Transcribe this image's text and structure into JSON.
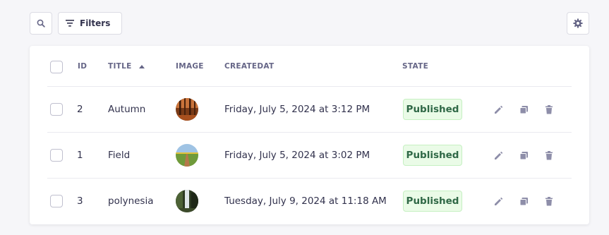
{
  "toolbar": {
    "filters_label": "Filters"
  },
  "table": {
    "headers": {
      "id": "ID",
      "title": "TITLE",
      "image": "IMAGE",
      "createdat": "CREATEDAT",
      "state": "STATE"
    },
    "sort": {
      "column": "title",
      "direction": "ascending"
    },
    "rows": [
      {
        "id": "2",
        "title": "Autumn",
        "createdat": "Friday, July 5, 2024 at 3:12 PM",
        "state": "Published"
      },
      {
        "id": "1",
        "title": "Field",
        "createdat": "Friday, July 5, 2024 at 3:02 PM",
        "state": "Published"
      },
      {
        "id": "3",
        "title": "polynesia",
        "createdat": "Tuesday, July 9, 2024 at 11:18 AM",
        "state": "Published"
      }
    ]
  },
  "colors": {
    "page_bg": "#f6f6f9",
    "badge_bg": "#eafbe7",
    "badge_text": "#2f6846",
    "icon": "#8e8ea9"
  }
}
